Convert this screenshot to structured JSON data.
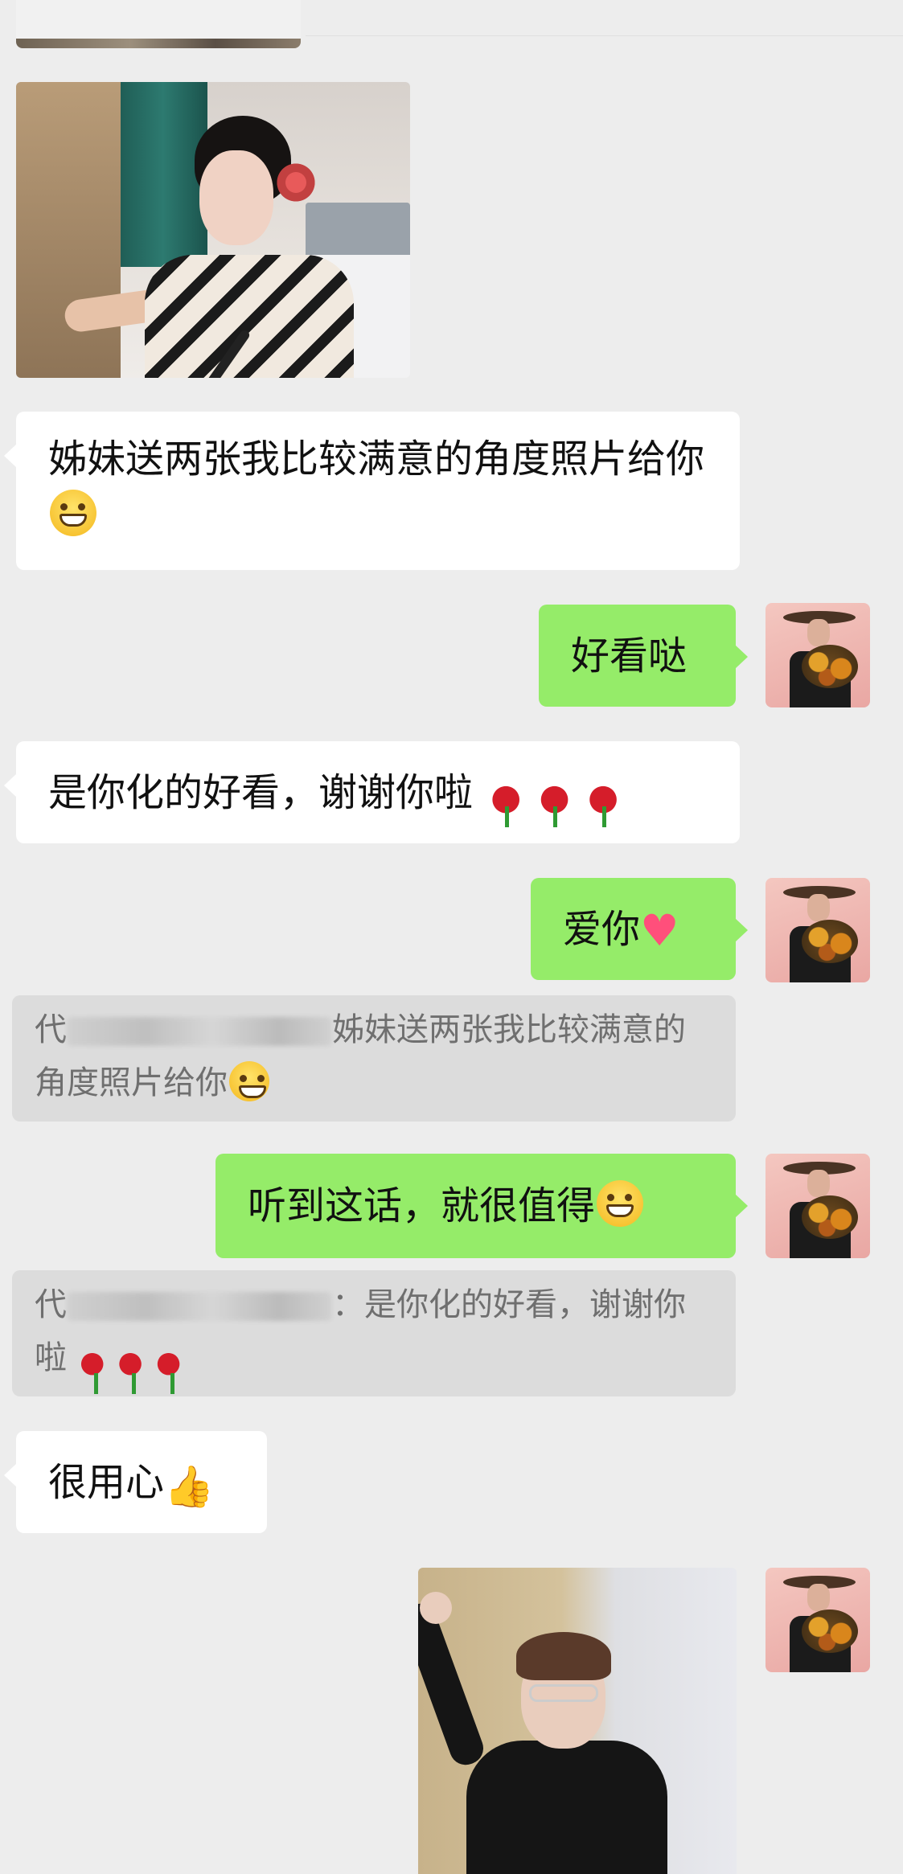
{
  "messages": {
    "m1": {
      "text": "姊妹送两张我比较满意的角度照片给你"
    },
    "m2": {
      "text": "好看哒"
    },
    "m3": {
      "text": "是你化的好看，谢谢你啦"
    },
    "m4": {
      "text": "爱你"
    },
    "q1": {
      "prefix": "代",
      "suffix": "姊妹送两张我比较满意的角度照片给你"
    },
    "m5": {
      "text": "听到这话，就很值得"
    },
    "q2": {
      "prefix": "代",
      "suffix": "：是你化的好看，谢谢你啦"
    },
    "m6": {
      "text": "很用心"
    }
  },
  "icons": {
    "grin": "grinning-face-icon",
    "heart": "heart-icon",
    "rose": "rose-icon",
    "thumb": "thumbs-up-icon"
  },
  "colors": {
    "background": "#ededed",
    "incoming_bubble": "#ffffff",
    "outgoing_bubble": "#95ec69",
    "quote_bubble": "#dcdcdc"
  }
}
